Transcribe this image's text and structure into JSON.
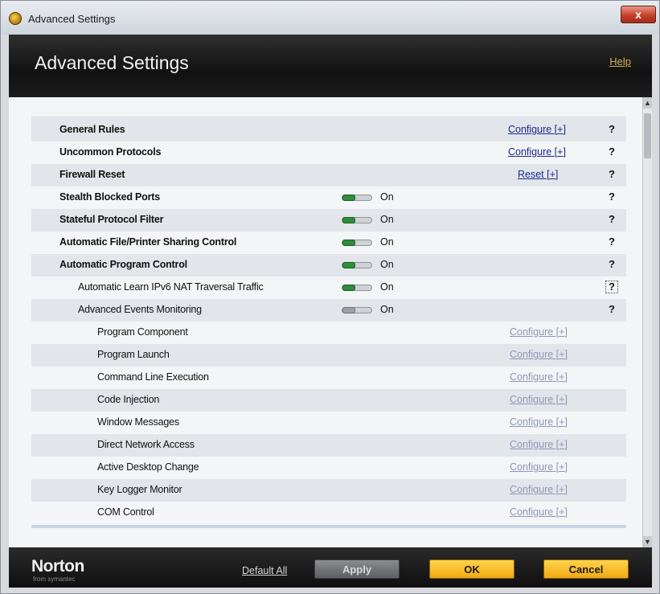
{
  "window": {
    "title": "Advanced Settings",
    "close_label": "x"
  },
  "header": {
    "title": "Advanced Settings",
    "help_label": "Help"
  },
  "rows": [
    {
      "label": "General Rules",
      "level": 0,
      "action": "Configure [+]",
      "help": "?"
    },
    {
      "label": "Uncommon Protocols",
      "level": 0,
      "action": "Configure [+]",
      "help": "?"
    },
    {
      "label": "Firewall Reset",
      "level": 0,
      "action": "Reset [+]",
      "help": "?"
    },
    {
      "label": "Stealth Blocked Ports",
      "level": 0,
      "toggle": "On",
      "help": "?"
    },
    {
      "label": "Stateful Protocol Filter",
      "level": 0,
      "toggle": "On",
      "help": "?"
    },
    {
      "label": "Automatic File/Printer Sharing Control",
      "level": 0,
      "toggle": "On",
      "help": "?"
    },
    {
      "label": "Automatic Program Control",
      "level": 0,
      "toggle": "On",
      "help": "?"
    },
    {
      "label": "Automatic Learn IPv6 NAT Traversal Traffic",
      "level": 1,
      "toggle": "On",
      "help": "?"
    },
    {
      "label": "Advanced Events Monitoring",
      "level": 1,
      "toggle": "On",
      "help": "?"
    },
    {
      "label": "Program Component",
      "level": 2,
      "action": "Configure [+]"
    },
    {
      "label": "Program Launch",
      "level": 2,
      "action": "Configure [+]"
    },
    {
      "label": "Command Line Execution",
      "level": 2,
      "action": "Configure [+]"
    },
    {
      "label": "Code Injection",
      "level": 2,
      "action": "Configure [+]"
    },
    {
      "label": "Window Messages",
      "level": 2,
      "action": "Configure [+]"
    },
    {
      "label": "Direct Network Access",
      "level": 2,
      "action": "Configure [+]"
    },
    {
      "label": "Active Desktop Change",
      "level": 2,
      "action": "Configure [+]"
    },
    {
      "label": "Key Logger Monitor",
      "level": 2,
      "action": "Configure [+]"
    },
    {
      "label": "COM Control",
      "level": 2,
      "action": "Configure [+]"
    }
  ],
  "footer": {
    "brand": "Norton",
    "brand_sub": "from symantec",
    "default_all": "Default All",
    "apply": "Apply",
    "ok": "OK",
    "cancel": "Cancel"
  }
}
